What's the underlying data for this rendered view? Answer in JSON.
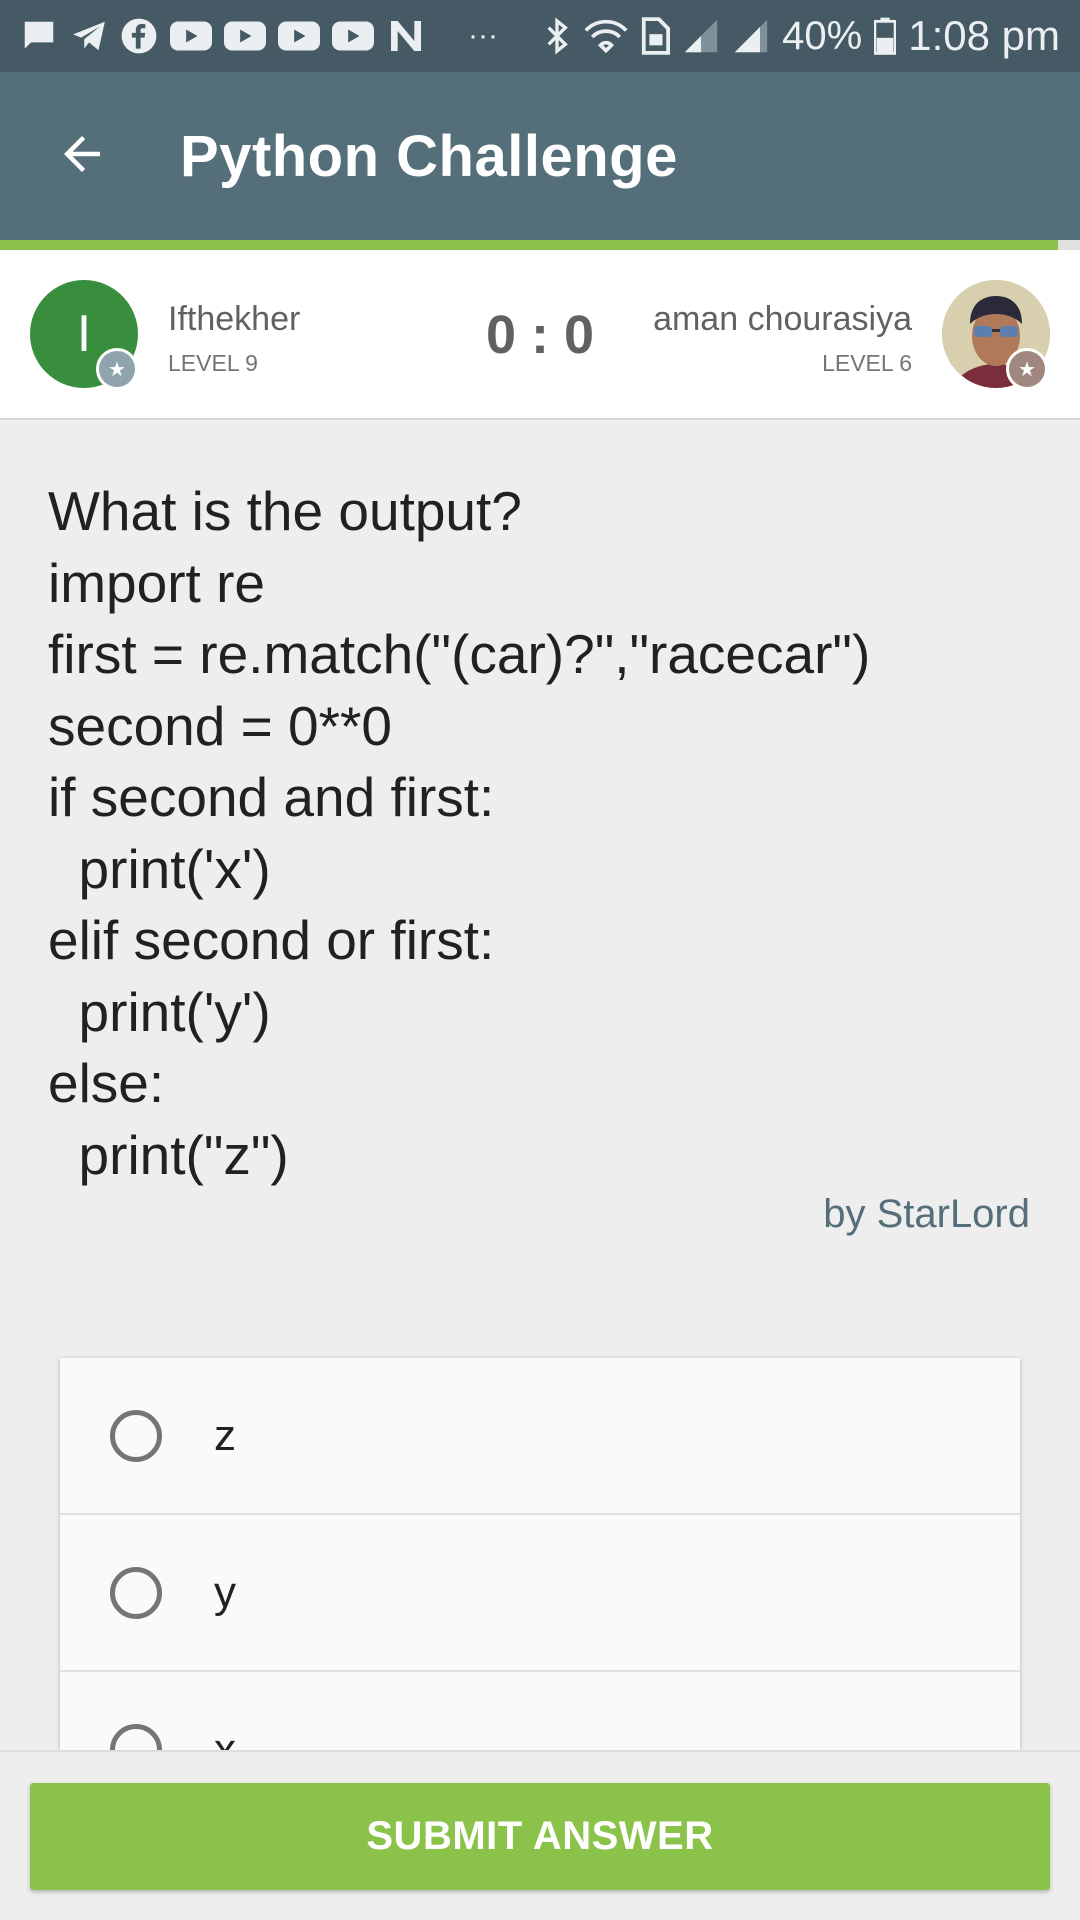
{
  "status_bar": {
    "notification_icons": [
      "message-icon",
      "telegram-icon",
      "facebook-icon",
      "youtube-icon",
      "youtube-icon",
      "youtube-icon",
      "youtube-icon",
      "n-app-icon"
    ],
    "more": "···",
    "battery": "40%",
    "time": "1:08 pm"
  },
  "header": {
    "title": "Python Challenge",
    "progress": 0.98
  },
  "players": {
    "left": {
      "initial": "I",
      "name": "Ifthekher",
      "level": "LEVEL 9"
    },
    "right": {
      "name": "aman chourasiya",
      "level": "LEVEL 6"
    },
    "score": "0 : 0"
  },
  "question": {
    "text": "What is the output?\nimport re\nfirst = re.match(\"(car)?\",\"racecar\")\nsecond = 0**0\nif second and first:\n  print('x')\nelif second or first:\n  print('y')\nelse:\n  print(\"z\")",
    "author": "by StarLord"
  },
  "options": [
    {
      "label": "z"
    },
    {
      "label": "y"
    },
    {
      "label": "x"
    }
  ],
  "submit": {
    "label": "SUBMIT ANSWER"
  },
  "colors": {
    "app_bar": "#546e7a",
    "status_bar": "#455a64",
    "accent": "#8bc34a"
  }
}
